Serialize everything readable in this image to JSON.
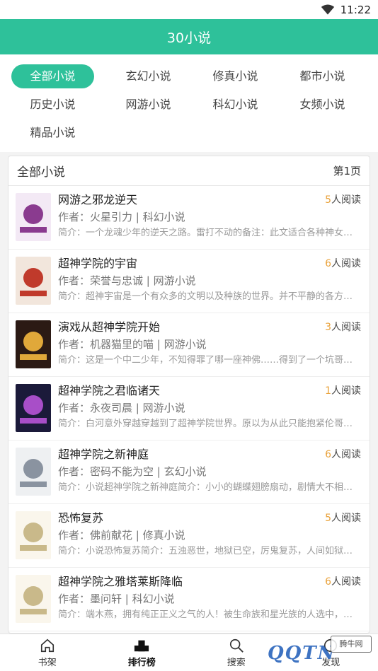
{
  "status_bar": {
    "time": "11:22",
    "wifi_icon": "wifi-icon"
  },
  "app": {
    "title": "30小说"
  },
  "categories": [
    {
      "label": "全部小说",
      "active": true
    },
    {
      "label": "玄幻小说"
    },
    {
      "label": "修真小说"
    },
    {
      "label": "都市小说"
    },
    {
      "label": "历史小说"
    },
    {
      "label": "网游小说"
    },
    {
      "label": "科幻小说"
    },
    {
      "label": "女频小说"
    },
    {
      "label": "精品小说"
    }
  ],
  "panel": {
    "title": "全部小说",
    "page": "第1页"
  },
  "books": [
    {
      "title": "网游之邪龙逆天",
      "reads_count": "5",
      "reads_suffix": "人阅读",
      "meta": "作者：火星引力 | 科幻小说",
      "intro": "简介：一个龙魂少年的逆天之路。雷打不动的备注：此文适合各种神女…",
      "cover_colors": [
        "#f3e9f5",
        "#8a3b8f"
      ]
    },
    {
      "title": "超神学院的宇宙",
      "reads_count": "6",
      "reads_suffix": "人阅读",
      "meta": "作者：荣誉与忠诚 | 网游小说",
      "intro": "简介：超神宇宙是一个有众多的文明以及种族的世界。并不平静的各方…",
      "cover_colors": [
        "#f2e6dc",
        "#c03a2b"
      ]
    },
    {
      "title": "演戏从超神学院开始",
      "reads_count": "3",
      "reads_suffix": "人阅读",
      "meta": "作者：机器猫里的喵 | 网游小说",
      "intro": "简介：这是一个中二少年，不知得罪了哪一座神佛……得到了一个坑哥的…",
      "cover_colors": [
        "#2b1a14",
        "#e0a83a"
      ]
    },
    {
      "title": "超神学院之君临诸天",
      "reads_count": "1",
      "reads_suffix": "人阅读",
      "meta": "作者：永夜司晨 | 网游小说",
      "intro": "简介：白河意外穿越穿越到了超神学院世界。原以为从此只能抱紧伦哥…",
      "cover_colors": [
        "#1b1a3a",
        "#a84ec8"
      ]
    },
    {
      "title": "超神学院之新神庭",
      "reads_count": "6",
      "reads_suffix": "人阅读",
      "meta": "作者：密码不能为空 | 玄幻小说",
      "intro": "简介：小说超神学院之新神庭简介：小小的蝴蝶翅膀扇动，剧情大不相…",
      "cover_colors": [
        "#eef0f2",
        "#8a93a0"
      ]
    },
    {
      "title": "恐怖复苏",
      "reads_count": "5",
      "reads_suffix": "人阅读",
      "meta": "作者：佛前献花 | 修真小说",
      "intro": "简介：小说恐怖复苏简介：五浊恶世，地狱已空，厉鬼复苏，人间如狱…",
      "cover_colors": [
        "#faf6ec",
        "#c9b98a"
      ]
    },
    {
      "title": "超神学院之雅塔莱斯降临",
      "reads_count": "6",
      "reads_suffix": "人阅读",
      "meta": "作者：墨问轩 | 科幻小说",
      "intro": "简介：端木燕，拥有纯正正义之气的人！被生命族和星光族的人选中，…",
      "cover_colors": [
        "#faf6ec",
        "#c9b98a"
      ]
    }
  ],
  "tabs": [
    {
      "label": "书架",
      "icon": "home-icon"
    },
    {
      "label": "排行榜",
      "icon": "ranking-icon",
      "active": true
    },
    {
      "label": "搜索",
      "icon": "search-icon"
    },
    {
      "label": "发现",
      "icon": "discover-icon"
    }
  ],
  "watermark": {
    "text": "QQTN",
    "badge": "腾牛网"
  }
}
